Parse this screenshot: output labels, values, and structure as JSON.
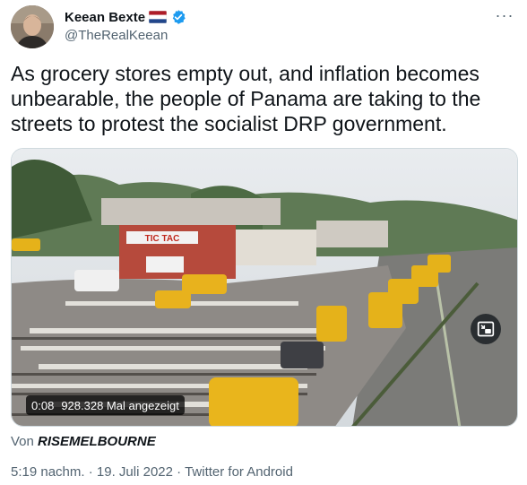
{
  "author": {
    "display_name": "Keean Bexte",
    "handle": "@TheRealKeean",
    "flag_icon": "netherlands-flag-icon",
    "verified_icon": "verified-badge-icon"
  },
  "more_label": "···",
  "tweet": {
    "text": "As grocery stores empty out, and inflation becomes unbearable, the people of Panama are taking to the streets to protest the socialist DRP government."
  },
  "video": {
    "time": "0:08",
    "views": "928.328 Mal angezeigt",
    "sign_text": "TIC TAC"
  },
  "attribution": {
    "prefix": "Von",
    "source": "RISEMELBOURNE"
  },
  "meta": {
    "time": "5:19 nachm.",
    "sep1": "·",
    "date": "19. Juli 2022",
    "sep2": "·",
    "client": "Twitter for Android"
  },
  "colors": {
    "verified": "#1d9bf0",
    "secondary_text": "#536471",
    "primary_text": "#0f1419"
  }
}
